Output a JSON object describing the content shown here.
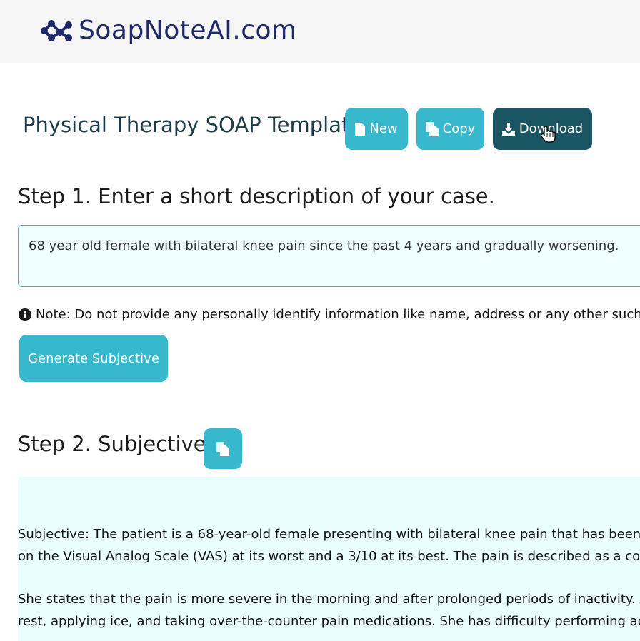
{
  "header": {
    "brand": "SoapNoteAI.com"
  },
  "page": {
    "title": "Physical Therapy SOAP Template",
    "new_label": "New",
    "copy_label": "Copy",
    "download_label": "Download"
  },
  "step1": {
    "title": "Step 1. Enter a short description of your case.",
    "input_value": "68 year old female with bilateral knee pain since the past 4 years and gradually worsening.",
    "note": "Note: Do not provide any personally identify information like name, address or any other such",
    "generate_label": "Generate Subjective"
  },
  "step2": {
    "title": "Step 2. Subjective",
    "paragraphs": [
      [
        "Subjective: The patient is a 68-year-old female presenting with bilateral knee pain that has been",
        "on the Visual Analog Scale (VAS) at its worst and a 3/10 at its best. The pain is described as a co"
      ],
      [
        "She states that the pain is more severe in the morning and after prolonged periods of inactivity. A",
        "rest, applying ice, and taking over-the-counter pain medications. She has difficulty performing ac"
      ]
    ]
  },
  "colors": {
    "brand": "#1f2a68",
    "teal": "#38b8cc",
    "dark_teal": "#1a5563",
    "input_bg": "#efffff",
    "subjective_bg": "#eafffd"
  },
  "icons": {
    "logo": "molecule-logo-icon",
    "new": "file-icon",
    "copy": "copy-icon",
    "download": "download-icon",
    "note": "info-circle-icon",
    "cursor": "hand-pointer-icon"
  }
}
